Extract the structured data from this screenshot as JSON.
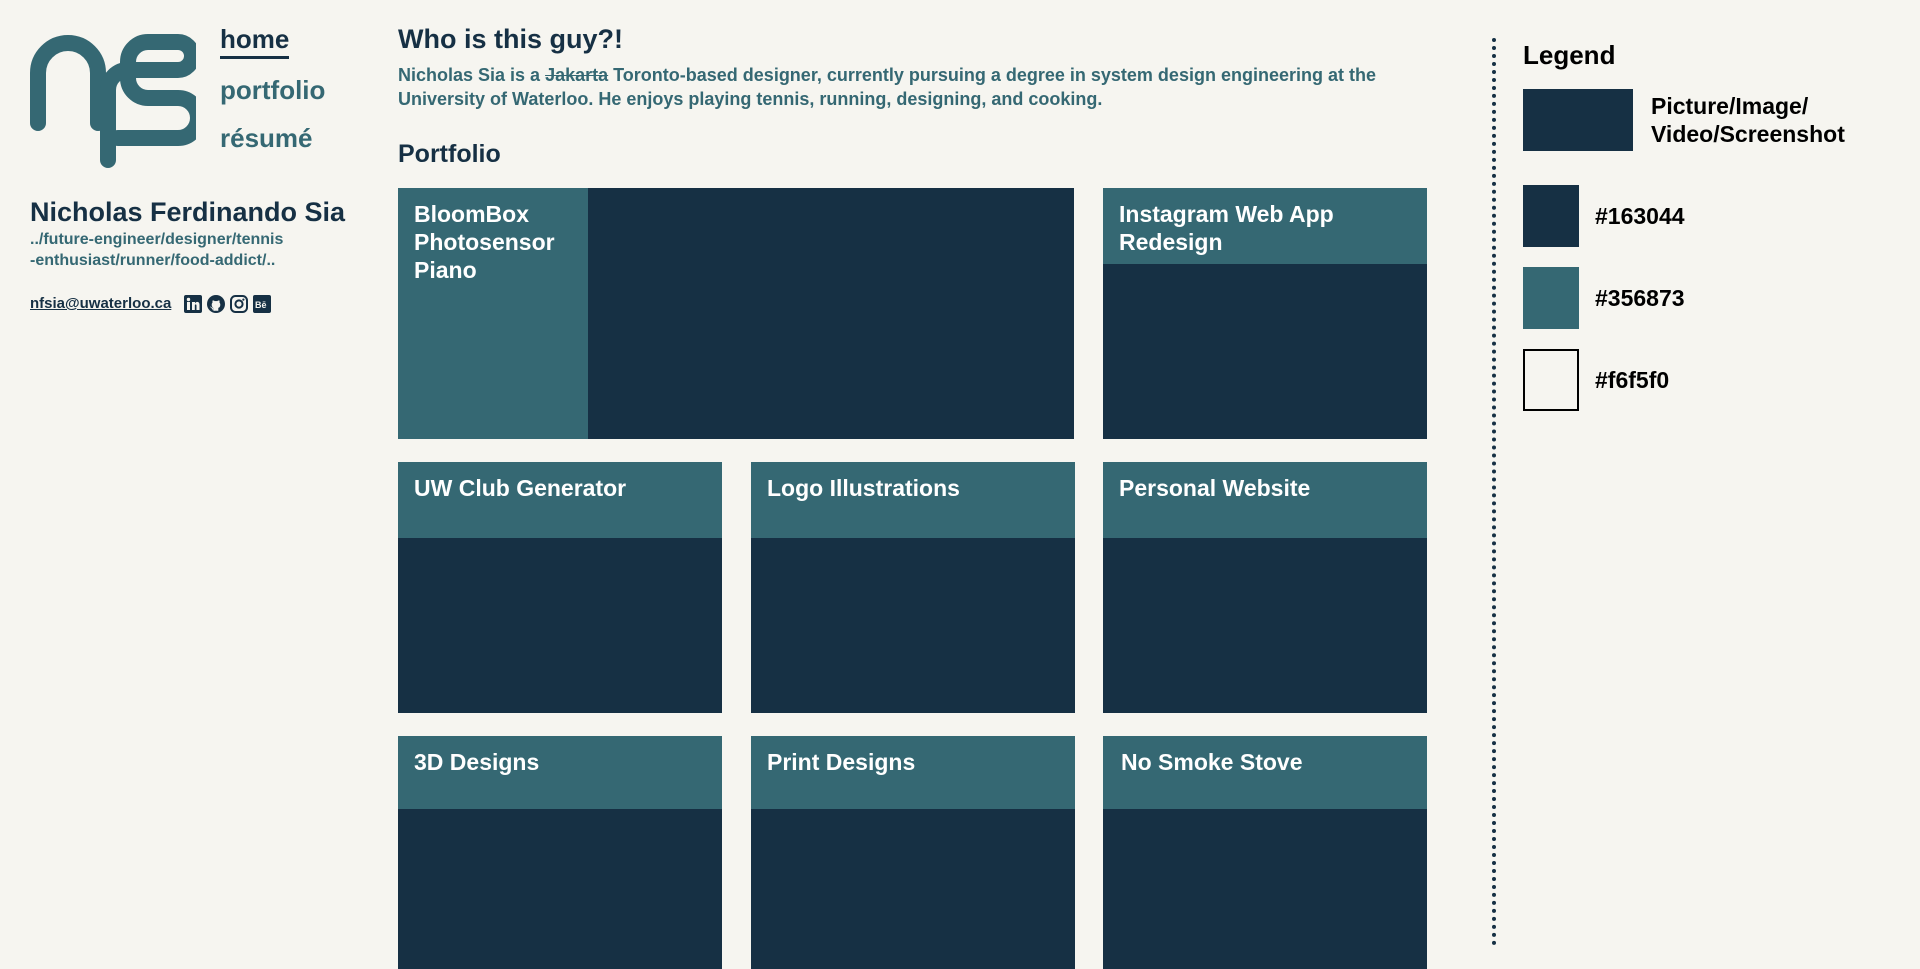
{
  "colors": {
    "dark": "#163044",
    "teal": "#356873",
    "background": "#f6f5f0"
  },
  "logo": {
    "alt": "nfs"
  },
  "nav": {
    "items": [
      {
        "label": "home",
        "active": true
      },
      {
        "label": "portfolio",
        "active": false
      },
      {
        "label": "résumé",
        "active": false
      }
    ]
  },
  "profile": {
    "name": "Nicholas Ferdinando Sia",
    "tagline_line1": "../future-engineer/designer/tennis",
    "tagline_line2": "-enthusiast/runner/food-addict/..",
    "email": "nfsia@uwaterloo.ca",
    "social_icons": [
      "linkedin-icon",
      "github-icon",
      "instagram-icon",
      "behance-icon"
    ]
  },
  "about": {
    "title": "Who is this guy?!",
    "text_before": "Nicholas Sia is a ",
    "struck_word": "Jakarta",
    "text_after": " Toronto-based designer, currently pursuing a degree in system design engineering at the University of Waterloo. He enjoys playing tennis, running, designing, and cooking."
  },
  "portfolio": {
    "title": "Portfolio",
    "items": [
      {
        "label": "BloomBox Photosensor Piano"
      },
      {
        "label": "Instagram Web App Redesign"
      },
      {
        "label": "UW Club Generator"
      },
      {
        "label": "Logo Illustrations"
      },
      {
        "label": "Personal Website"
      },
      {
        "label": "3D Designs"
      },
      {
        "label": "Print Designs"
      },
      {
        "label": "No Smoke Stove"
      }
    ]
  },
  "legend": {
    "title": "Legend",
    "items": [
      {
        "label": "Picture/Image/\nVideo/Screenshot",
        "color": "#163044"
      },
      {
        "label": "#163044",
        "color": "#163044"
      },
      {
        "label": "#356873",
        "color": "#356873"
      },
      {
        "label": "#f6f5f0",
        "color": "#f6f5f0"
      }
    ]
  }
}
